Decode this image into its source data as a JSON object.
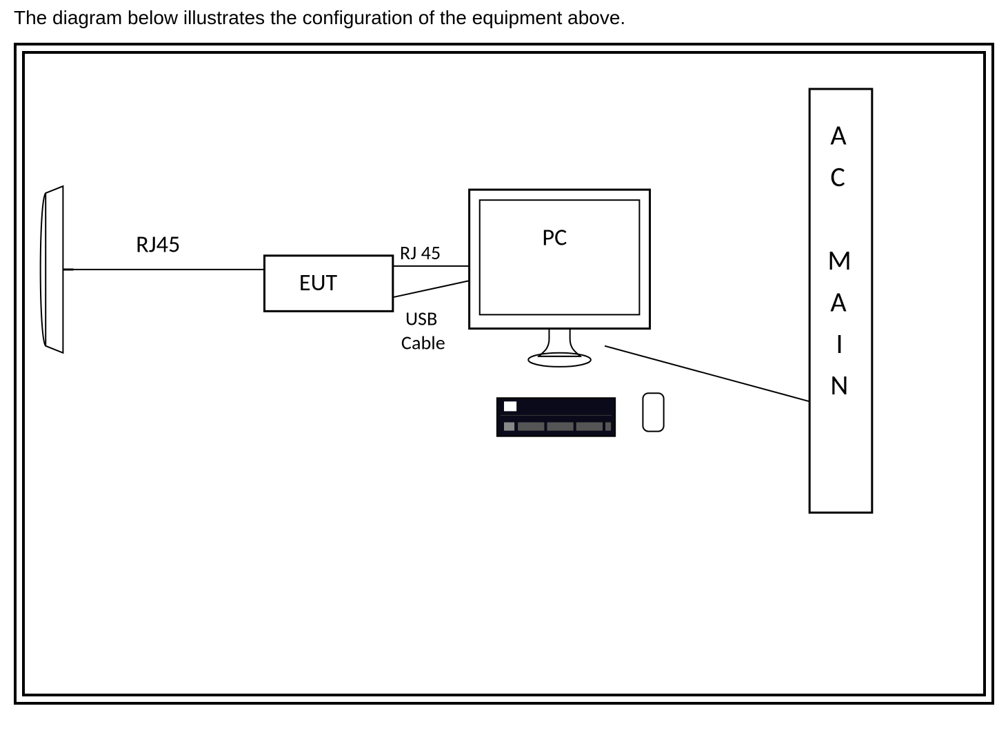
{
  "caption": "The diagram below illustrates the configuration of the equipment above.",
  "nodes": {
    "antenna": {
      "label": ""
    },
    "eut": {
      "label": "EUT"
    },
    "pc": {
      "label": "PC"
    },
    "keyboard": {
      "label": ""
    },
    "mouse": {
      "label": ""
    },
    "ac_main": {
      "label": "A C   M A I N"
    }
  },
  "connections": {
    "antenna_to_eut": {
      "label": "RJ45"
    },
    "eut_to_pc_top": {
      "label": "RJ 45"
    },
    "eut_to_pc_bottom_line1": {
      "label": "USB"
    },
    "eut_to_pc_bottom_line2": {
      "label": "Cable"
    },
    "pc_to_ac": {
      "label": ""
    }
  }
}
